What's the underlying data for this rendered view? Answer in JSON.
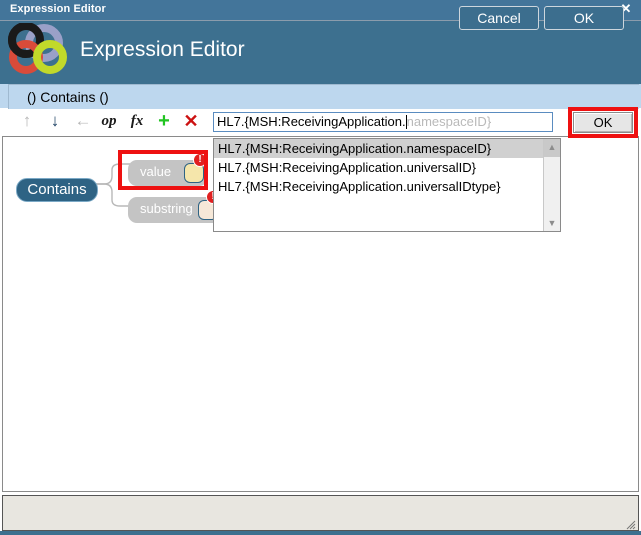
{
  "window": {
    "title": "Expression Editor",
    "close_icon": "close-icon"
  },
  "banner": {
    "title": "Expression Editor",
    "logo_name": "application-logo",
    "logo_colors": {
      "ring_black": "#1a1a1a",
      "ring_lavender": "#9aa0c8",
      "ring_red": "#d94b3a",
      "ring_green": "#c2d92a"
    }
  },
  "expression_band": {
    "text": "() Contains ()",
    "background": "#bdd7ee"
  },
  "toolbar": {
    "items": [
      {
        "name": "move-up-icon",
        "glyph": "↑",
        "state": "disabled"
      },
      {
        "name": "move-down-icon",
        "glyph": "↓",
        "state": "enabled"
      },
      {
        "name": "move-left-icon",
        "glyph": "←",
        "state": "disabled"
      },
      {
        "name": "operator-icon",
        "glyph": "op",
        "state": "enabled"
      },
      {
        "name": "function-icon",
        "glyph": "fx",
        "state": "enabled"
      },
      {
        "name": "add-icon",
        "glyph": "+",
        "state": "enabled"
      },
      {
        "name": "delete-icon",
        "glyph": "✕",
        "state": "enabled"
      }
    ]
  },
  "expression_input": {
    "typed_value": "HL7.{MSH:ReceivingApplication.",
    "inline_suggestion": "namespaceID}",
    "full_value": "HL7.{MSH:ReceivingApplication.namespaceID}"
  },
  "autocomplete": {
    "items": [
      {
        "label": "HL7.{MSH:ReceivingApplication.namespaceID}",
        "selected": true
      },
      {
        "label": "HL7.{MSH:ReceivingApplication.universalID}",
        "selected": false
      },
      {
        "label": "HL7.{MSH:ReceivingApplication.universalIDtype}",
        "selected": false
      }
    ],
    "scroll_up_glyph": "▲",
    "scroll_down_glyph": "▼"
  },
  "graph": {
    "function_node": {
      "label": "Contains",
      "color": "#2e6384"
    },
    "parameters": [
      {
        "label": "value",
        "socket_color": "#f5e6ab",
        "error": true,
        "error_glyph": "!"
      },
      {
        "label": "substring",
        "socket_color": "#f6e8d8",
        "error": true,
        "error_glyph": "!"
      }
    ]
  },
  "annotations": {
    "color": "#ee1111",
    "targets": [
      "value-parameter-node",
      "apply-ok-button"
    ]
  },
  "buttons": {
    "apply_ok": "OK",
    "cancel": "Cancel",
    "ok": "OK"
  }
}
